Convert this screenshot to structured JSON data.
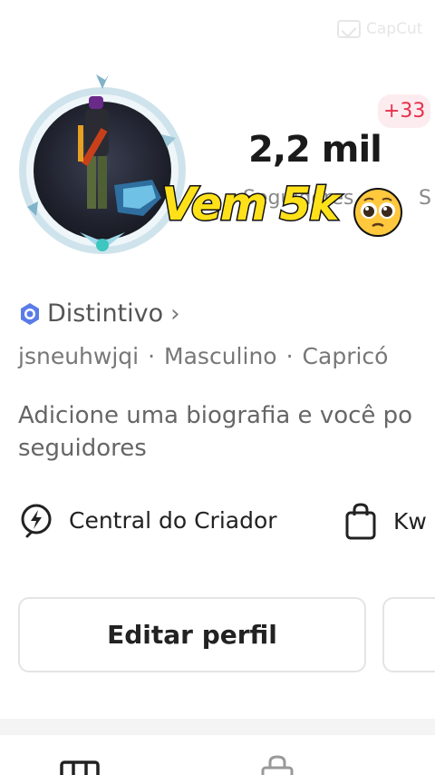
{
  "watermark": {
    "text": "CapCut"
  },
  "profile": {
    "notification_badge": "+33",
    "followers_count": "2,2 mil",
    "followers_label": "Seguidores",
    "following_label": "S",
    "overlay_caption": "Vem 5k",
    "overlay_emoji": "pleading-face-emoji",
    "badge_link": {
      "label": "Distintivo",
      "chevron": "›"
    },
    "meta": {
      "username": "jsneuhwjqi",
      "gender": "Masculino",
      "sign": "Capricó",
      "separator": "·"
    },
    "bio": {
      "line1": "Adicione uma biografia e você po",
      "line2": "seguidores"
    }
  },
  "links": {
    "creator_center": "Central do Criador",
    "shop": "Kw"
  },
  "actions": {
    "edit_profile": "Editar perfil"
  },
  "colors": {
    "accent_red": "#e8304a",
    "badge_bg": "#fdecef",
    "overlay_yellow": "#ffe11a"
  }
}
